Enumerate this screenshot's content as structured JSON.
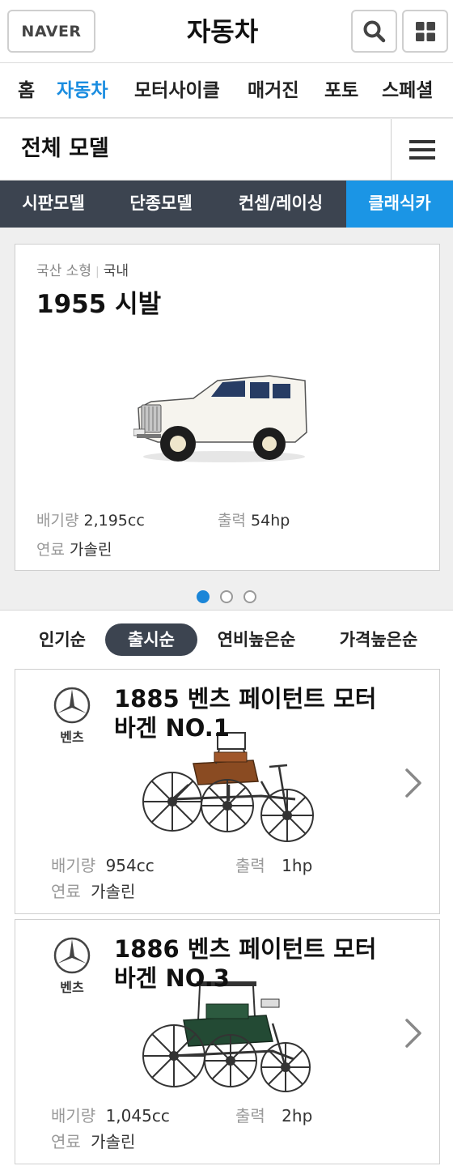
{
  "header": {
    "logo": "NAVER",
    "title": "자동차"
  },
  "nav": {
    "items": [
      {
        "label": "홈"
      },
      {
        "label": "자동차"
      },
      {
        "label": "모터사이클"
      },
      {
        "label": "매거진"
      },
      {
        "label": "포토"
      },
      {
        "label": "스페셜"
      }
    ],
    "active_index": 1
  },
  "models_bar": {
    "title": "전체 모델"
  },
  "category_tabs": [
    {
      "label": "시판모델"
    },
    {
      "label": "단종모델"
    },
    {
      "label": "컨셉/레이싱"
    },
    {
      "label": "클래식카"
    }
  ],
  "featured": {
    "category": "국산 소형",
    "origin": "국내",
    "title": "1955 시발",
    "displacement_label": "배기량",
    "displacement": "2,195cc",
    "power_label": "출력",
    "power": "54hp",
    "fuel_label": "연료",
    "fuel": "가솔린",
    "page_count": 3,
    "active_page": 1
  },
  "sort": {
    "options": [
      {
        "label": "인기순"
      },
      {
        "label": "출시순"
      },
      {
        "label": "연비높은순"
      },
      {
        "label": "가격높은순"
      }
    ],
    "active_index": 1
  },
  "cars": [
    {
      "brand": "벤츠",
      "title": "1885 벤츠 페이턴트 모터 바겐 NO.1",
      "displacement_label": "배기량",
      "displacement": "954cc",
      "power_label": "출력",
      "power": "1hp",
      "fuel_label": "연료",
      "fuel": "가솔린"
    },
    {
      "brand": "벤츠",
      "title": "1886 벤츠 페이턴트 모터 바겐 NO.3",
      "displacement_label": "배기량",
      "displacement": "1,045cc",
      "power_label": "출력",
      "power": "2hp",
      "fuel_label": "연료",
      "fuel": "가솔린"
    }
  ],
  "colors": {
    "accent": "#1b95e5",
    "dark_tab": "#3c4450"
  }
}
